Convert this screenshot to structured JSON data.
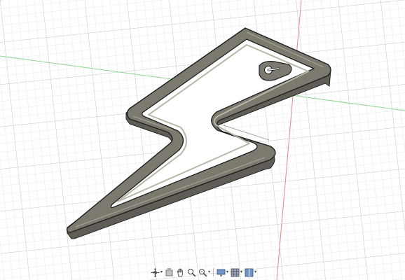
{
  "viewport": {
    "background": "#ffffff",
    "grid_minor_color": "#e3e3e3",
    "grid_major_color": "#c9c9c9",
    "axis_x_color": "#e08a8a",
    "axis_z_color": "#8fd48f",
    "model": {
      "shape": "lightning-bolt",
      "fill_color": "#7c7a6e",
      "outline_color": "#222222"
    }
  },
  "toolbar": {
    "items": [
      {
        "name": "orbit-icon",
        "has_menu": true
      },
      {
        "name": "look-at-icon",
        "has_menu": false
      },
      {
        "name": "pan-icon",
        "has_menu": false
      },
      {
        "name": "zoom-icon",
        "has_menu": false
      },
      {
        "name": "fit-icon",
        "has_menu": true
      },
      {
        "name": "display-settings-icon",
        "has_menu": true
      },
      {
        "name": "grid-snaps-icon",
        "has_menu": true
      },
      {
        "name": "viewports-icon",
        "has_menu": true
      }
    ]
  }
}
